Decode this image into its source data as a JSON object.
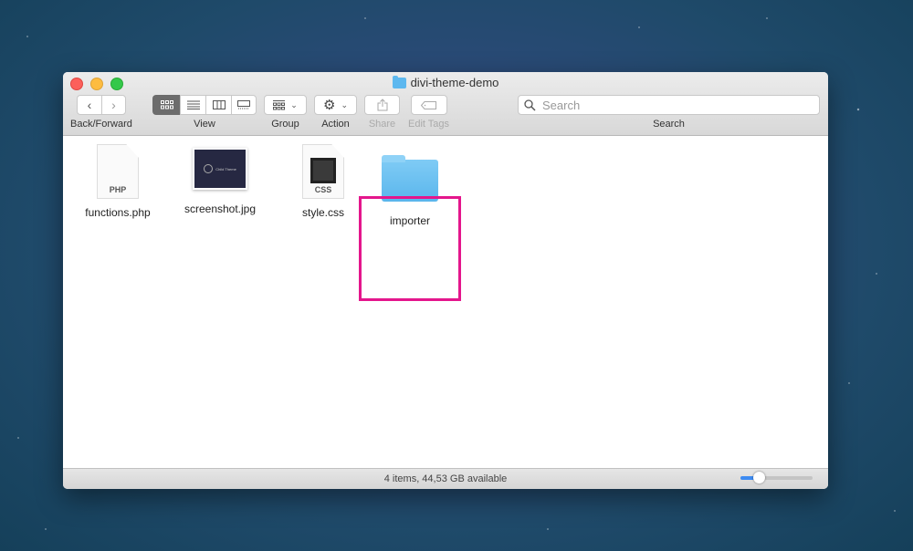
{
  "window": {
    "title": "divi-theme-demo"
  },
  "toolbar": {
    "back_forward_label": "Back/Forward",
    "back_icon": "chevron-left",
    "forward_icon": "chevron-right",
    "view_label": "View",
    "view_modes": [
      "icon",
      "list",
      "column",
      "gallery"
    ],
    "view_active": "icon",
    "group_label": "Group",
    "action_label": "Action",
    "share_label": "Share",
    "edit_tags_label": "Edit Tags",
    "search_label": "Search",
    "search_placeholder": "Search",
    "search_value": ""
  },
  "files": [
    {
      "name": "functions.php",
      "type": "document",
      "ext": "PHP"
    },
    {
      "name": "screenshot.jpg",
      "type": "image",
      "thumb_text": "Child Theme"
    },
    {
      "name": "style.css",
      "type": "document",
      "ext": "CSS"
    },
    {
      "name": "importer",
      "type": "folder",
      "highlighted": true
    }
  ],
  "highlight_color": "#e4168c",
  "statusbar": {
    "text": "4 items, 44,53 GB available",
    "icon_size_slider_fraction": 0.25
  }
}
